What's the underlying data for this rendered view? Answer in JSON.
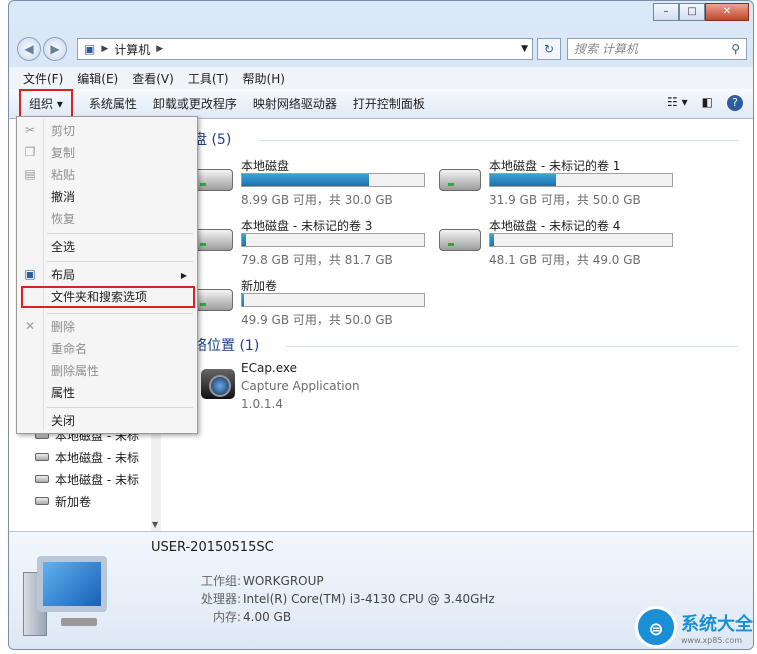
{
  "address": {
    "crumb": "计算机",
    "search_placeholder": "搜索 计算机"
  },
  "menubar": [
    "文件(F)",
    "编辑(E)",
    "查看(V)",
    "工具(T)",
    "帮助(H)"
  ],
  "toolbar": {
    "organize": "组织 ▾",
    "items": [
      "系统属性",
      "卸载或更改程序",
      "映射网络驱动器",
      "打开控制面板"
    ]
  },
  "sections": {
    "hard_disks": "硬盘 (5)",
    "network": "网络位置 (1)"
  },
  "drives": [
    {
      "name": "本地磁盘",
      "info": "8.99 GB 可用，共 30.0 GB",
      "used_fraction": 0.7
    },
    {
      "name": "本地磁盘 - 未标记的卷 1",
      "info": "31.9 GB 可用，共 50.0 GB",
      "used_fraction": 0.36
    },
    {
      "name": "本地磁盘 - 未标记的卷 3",
      "info": "79.8 GB 可用，共 81.7 GB",
      "used_fraction": 0.02
    },
    {
      "name": "本地磁盘 - 未标记的卷 4",
      "info": "48.1 GB 可用，共 49.0 GB",
      "used_fraction": 0.02
    },
    {
      "name": "新加卷",
      "info": "49.9 GB 可用，共 50.0 GB",
      "used_fraction": 0.0
    }
  ],
  "app": {
    "name": "ECap.exe",
    "desc": "Capture Application",
    "version": "1.0.1.4"
  },
  "navpane": [
    "本地磁盘 - 未标",
    "本地磁盘 - 未标",
    "本地磁盘 - 未标",
    "新加卷"
  ],
  "menu": {
    "cut": "剪切",
    "copy": "复制",
    "paste": "粘贴",
    "undo": "撤消",
    "redo": "恢复",
    "select_all": "全选",
    "layout": "布局",
    "folder_options": "文件夹和搜索选项",
    "delete": "删除",
    "rename": "重命名",
    "remove_props": "删除属性",
    "properties": "属性",
    "close": "关闭"
  },
  "details": {
    "computer_name": "USER-20150515SC",
    "workgroup_label": "工作组:",
    "workgroup": "WORKGROUP",
    "cpu_label": "处理器:",
    "cpu": "Intel(R) Core(TM) i3-4130 CPU @ 3.40GHz",
    "ram_label": "内存:",
    "ram": "4.00 GB"
  },
  "watermark": {
    "main": "系统大全",
    "sub": "www.xp85.com"
  }
}
